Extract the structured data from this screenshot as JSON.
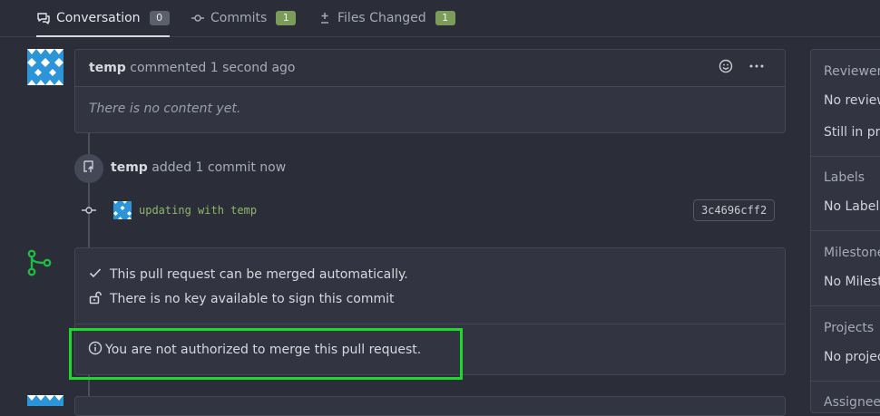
{
  "tabs": [
    {
      "label": "Conversation",
      "count": "0",
      "icon": "conversation-icon"
    },
    {
      "label": "Commits",
      "count": "1",
      "icon": "commit-icon"
    },
    {
      "label": "Files Changed",
      "count": "1",
      "icon": "diff-icon"
    }
  ],
  "comment": {
    "author": "temp",
    "action": "commented",
    "time": "1 second ago",
    "body": "There is no content yet.",
    "icons": [
      "smiley-icon",
      "kebab-icon"
    ]
  },
  "push_event": {
    "author": "temp",
    "text": "added 1 commit now"
  },
  "commit": {
    "message": "updating with temp",
    "sha": "3c4696cff2"
  },
  "merge_box": {
    "check_text": "This pull request can be merged automatically.",
    "key_text": "There is no key available to sign this commit",
    "auth_text": "You are not authorized to merge this pull request."
  },
  "sidebar": {
    "reviewers_title": "Reviewers",
    "reviewers_value_1": "No reviewers",
    "reviewers_value_2": "Still in progress",
    "labels_title": "Labels",
    "labels_value": "No Label",
    "milestone_title": "Milestone",
    "milestone_value": "No Milestone",
    "projects_title": "Projects",
    "projects_value": "No project",
    "assignees_title": "Assignees"
  },
  "colors": {
    "highlight": "#1fd92a",
    "merge_icon": "#21ba45",
    "commit_message": "#8fb56a"
  }
}
